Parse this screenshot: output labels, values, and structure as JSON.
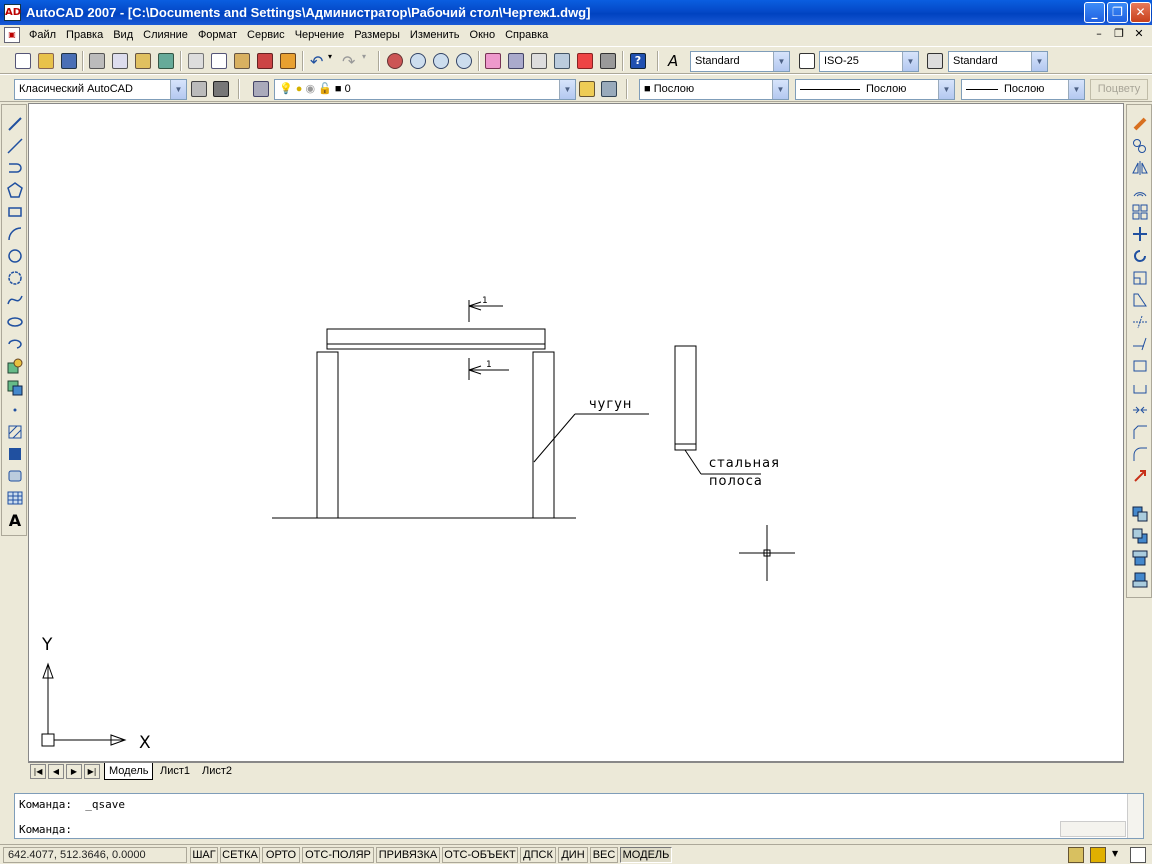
{
  "window": {
    "title": "AutoCAD 2007 - [C:\\Documents and Settings\\Администратор\\Рабочий стол\\Чертеж1.dwg]",
    "app_icon_text": "AD",
    "buttons": {
      "minimize": "_",
      "maximize": "❐",
      "close": "✕"
    }
  },
  "menu": {
    "items": [
      "Файл",
      "Правка",
      "Вид",
      "Слияние",
      "Формат",
      "Сервис",
      "Черчение",
      "Размеры",
      "Изменить",
      "Окно",
      "Справка"
    ],
    "mdi": {
      "minimize": "–",
      "restore": "❐",
      "close": "✕"
    }
  },
  "toolbar1": {
    "text_style": "Standard",
    "dim_style": "ISO-25",
    "table_style": "Standard"
  },
  "toolbar2": {
    "workspace": "Класический AutoCAD",
    "layer": "0",
    "color": "■ Послою",
    "linetype": "Послою",
    "lineweight": "Послою",
    "plot_style": "Поцвету"
  },
  "drawing": {
    "label_cast_iron": "чугун",
    "label_steel_1": "стальная",
    "label_steel_2": "полоса",
    "section_mark_top": "1",
    "section_mark_bottom": "1",
    "ucs_x": "X",
    "ucs_y": "Y"
  },
  "tabs": [
    "Модель",
    "Лист1",
    "Лист2"
  ],
  "command": {
    "line1": "Команда:  _qsave",
    "line2": "Команда:"
  },
  "status": {
    "coords": "642.4077,  512.3646, 0.0000",
    "buttons": [
      "ШАГ",
      "СЕТКА",
      "ОРТО",
      "ОТС-ПОЛЯР",
      "ПРИВЯЗКА",
      "ОТС-ОБЪЕКТ",
      "ДПСК",
      "ДИН",
      "ВЕС",
      "МОДЕЛЬ"
    ]
  }
}
